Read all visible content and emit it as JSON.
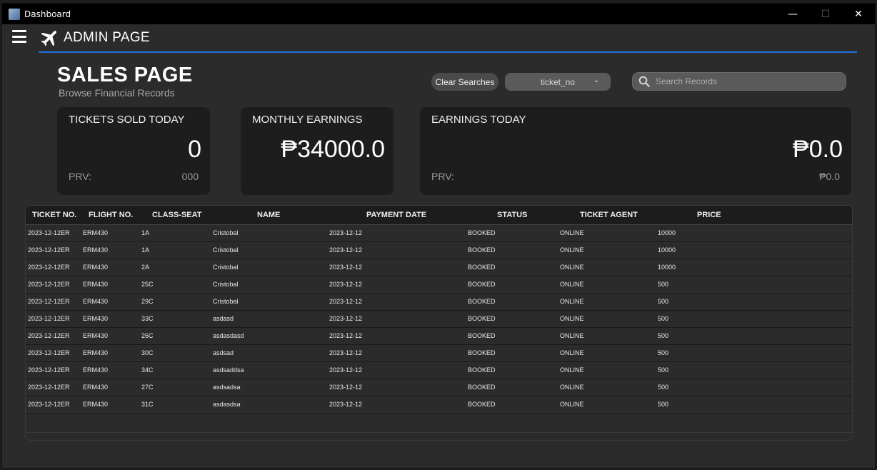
{
  "window": {
    "title": "Dashboard",
    "controls": {
      "minimize": "—",
      "maximize": "☐",
      "close": "✕"
    }
  },
  "header": {
    "title": "ADMIN PAGE",
    "accent_color": "#1d6fd8"
  },
  "page": {
    "title": "SALES PAGE",
    "subtitle": "Browse Financial Records"
  },
  "toolbar": {
    "clear_label": "Clear Searches",
    "filter_selected": "ticket_no",
    "search_placeholder": "Search Records"
  },
  "cards": [
    {
      "title": "TICKETS SOLD TODAY",
      "value": "0",
      "prv_label": "PRV:",
      "prv_value": "000"
    },
    {
      "title": "MONTHLY EARNINGS",
      "value": "₱34000.0"
    },
    {
      "title": "EARNINGS TODAY",
      "value": "₱0.0",
      "prv_label": "PRV:",
      "prv_value": "₱0.0"
    }
  ],
  "table": {
    "headers": [
      "TICKET NO.",
      "FLIGHT NO.",
      "CLASS-SEAT",
      "NAME",
      "PAYMENT DATE",
      "STATUS",
      "TICKET AGENT",
      "PRICE"
    ],
    "rows": [
      [
        "2023-12-12ER",
        "ERM430",
        "1A",
        "Cristobal",
        "2023-12-12",
        "BOOKED",
        "ONLINE",
        "10000"
      ],
      [
        "2023-12-12ER",
        "ERM430",
        "1A",
        "Cristobal",
        "2023-12-12",
        "BOOKED",
        "ONLINE",
        "10000"
      ],
      [
        "2023-12-12ER",
        "ERM430",
        "2A",
        "Cristobal",
        "2023-12-12",
        "BOOKED",
        "ONLINE",
        "10000"
      ],
      [
        "2023-12-12ER",
        "ERM430",
        "25C",
        "Cristobal",
        "2023-12-12",
        "BOOKED",
        "ONLINE",
        "500"
      ],
      [
        "2023-12-12ER",
        "ERM430",
        "29C",
        "Cristobal",
        "2023-12-12",
        "BOOKED",
        "ONLINE",
        "500"
      ],
      [
        "2023-12-12ER",
        "ERM430",
        "33C",
        "asdasd",
        "2023-12-12",
        "BOOKED",
        "ONLINE",
        "500"
      ],
      [
        "2023-12-12ER",
        "ERM430",
        "26C",
        "asdasdasd",
        "2023-12-12",
        "BOOKED",
        "ONLINE",
        "500"
      ],
      [
        "2023-12-12ER",
        "ERM430",
        "30C",
        "asdsad",
        "2023-12-12",
        "BOOKED",
        "ONLINE",
        "500"
      ],
      [
        "2023-12-12ER",
        "ERM430",
        "34C",
        "asdsaddsa",
        "2023-12-12",
        "BOOKED",
        "ONLINE",
        "500"
      ],
      [
        "2023-12-12ER",
        "ERM430",
        "27C",
        "asdsadsa",
        "2023-12-12",
        "BOOKED",
        "ONLINE",
        "500"
      ],
      [
        "2023-12-12ER",
        "ERM430",
        "31C",
        "asdasdsa",
        "2023-12-12",
        "BOOKED",
        "ONLINE",
        "500"
      ]
    ]
  }
}
